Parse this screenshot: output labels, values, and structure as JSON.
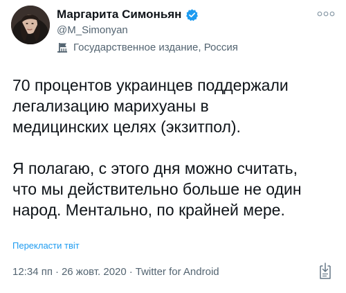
{
  "author": {
    "display_name": "Маргарита Симоньян",
    "handle": "@M_Simonyan",
    "label": "Государственное издание, Россия",
    "avatar_icon": "profile-photo",
    "verified_icon": "verified-badge-icon"
  },
  "tweet": {
    "text": "70 процентов украинцев поддержали\nлегализацию марихуаны в\nмедицинских целях (экзитпол).\n\nЯ полагаю, с этого дня можно считать,\nчто мы действительно больше не один\nнарод. Ментально, по крайней мере.",
    "translate_label": "Перекласти твіт",
    "time": "12:34 пп",
    "date": "26 жовт. 2020",
    "separator": "·",
    "source": "Twitter for Android"
  },
  "colors": {
    "text": "#0f1419",
    "secondary": "#536471",
    "accent": "#1d9bf0",
    "verified": "#1d9bf0"
  }
}
